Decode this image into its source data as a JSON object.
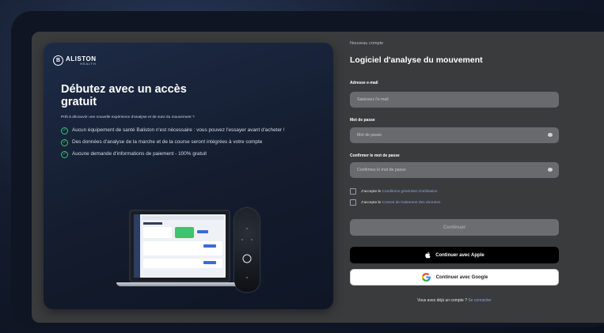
{
  "brand": {
    "mark_letter": "B",
    "name": "ALISTON",
    "sub": "HEALTH"
  },
  "promo": {
    "title": "Débutez avec un accès gratuit",
    "intro": "Prêt à découvrir une nouvelle expérience d'analyse et de suivi du mouvement ?",
    "features": [
      "Aucun équipement de santé Baliston n'est nécessaire : vous pouvez l'essayer avant d'acheter !",
      "Des données d'analyse de la marche et de la course seront intégrées à votre compte",
      "Aucune demande d'informations de paiement - 100% gratuit"
    ]
  },
  "form": {
    "eyebrow": "Nouveau compte",
    "title": "Logiciel d'analyse du mouvement",
    "email_label": "Adresse e-mail",
    "email_placeholder": "Saisissez l'e-mail",
    "password_label": "Mot de passe",
    "password_placeholder": "Mot de passe",
    "confirm_label": "Confirmer le mot de passe",
    "confirm_placeholder": "Confirmez le mot de passe",
    "consent_prefix": "J'accepte le",
    "terms_link": "Conditions générales d'utilisation",
    "data_link": "Contrat de traitement des données",
    "continue_label": "Continuer",
    "apple_label": "Continuer avec Apple",
    "google_label": "Continuer avec Google",
    "login_prompt": "Vous avez déjà un compte ?",
    "login_link": "Se connecter"
  },
  "icons": {
    "apple": "apple-icon",
    "google": "google-icon",
    "eye": "eye-icon",
    "check": "check-circle-icon"
  },
  "colors": {
    "accent_green": "#3cc46e",
    "link_blue": "#8ba4e0",
    "panel_dark": "#3a3b3d"
  }
}
